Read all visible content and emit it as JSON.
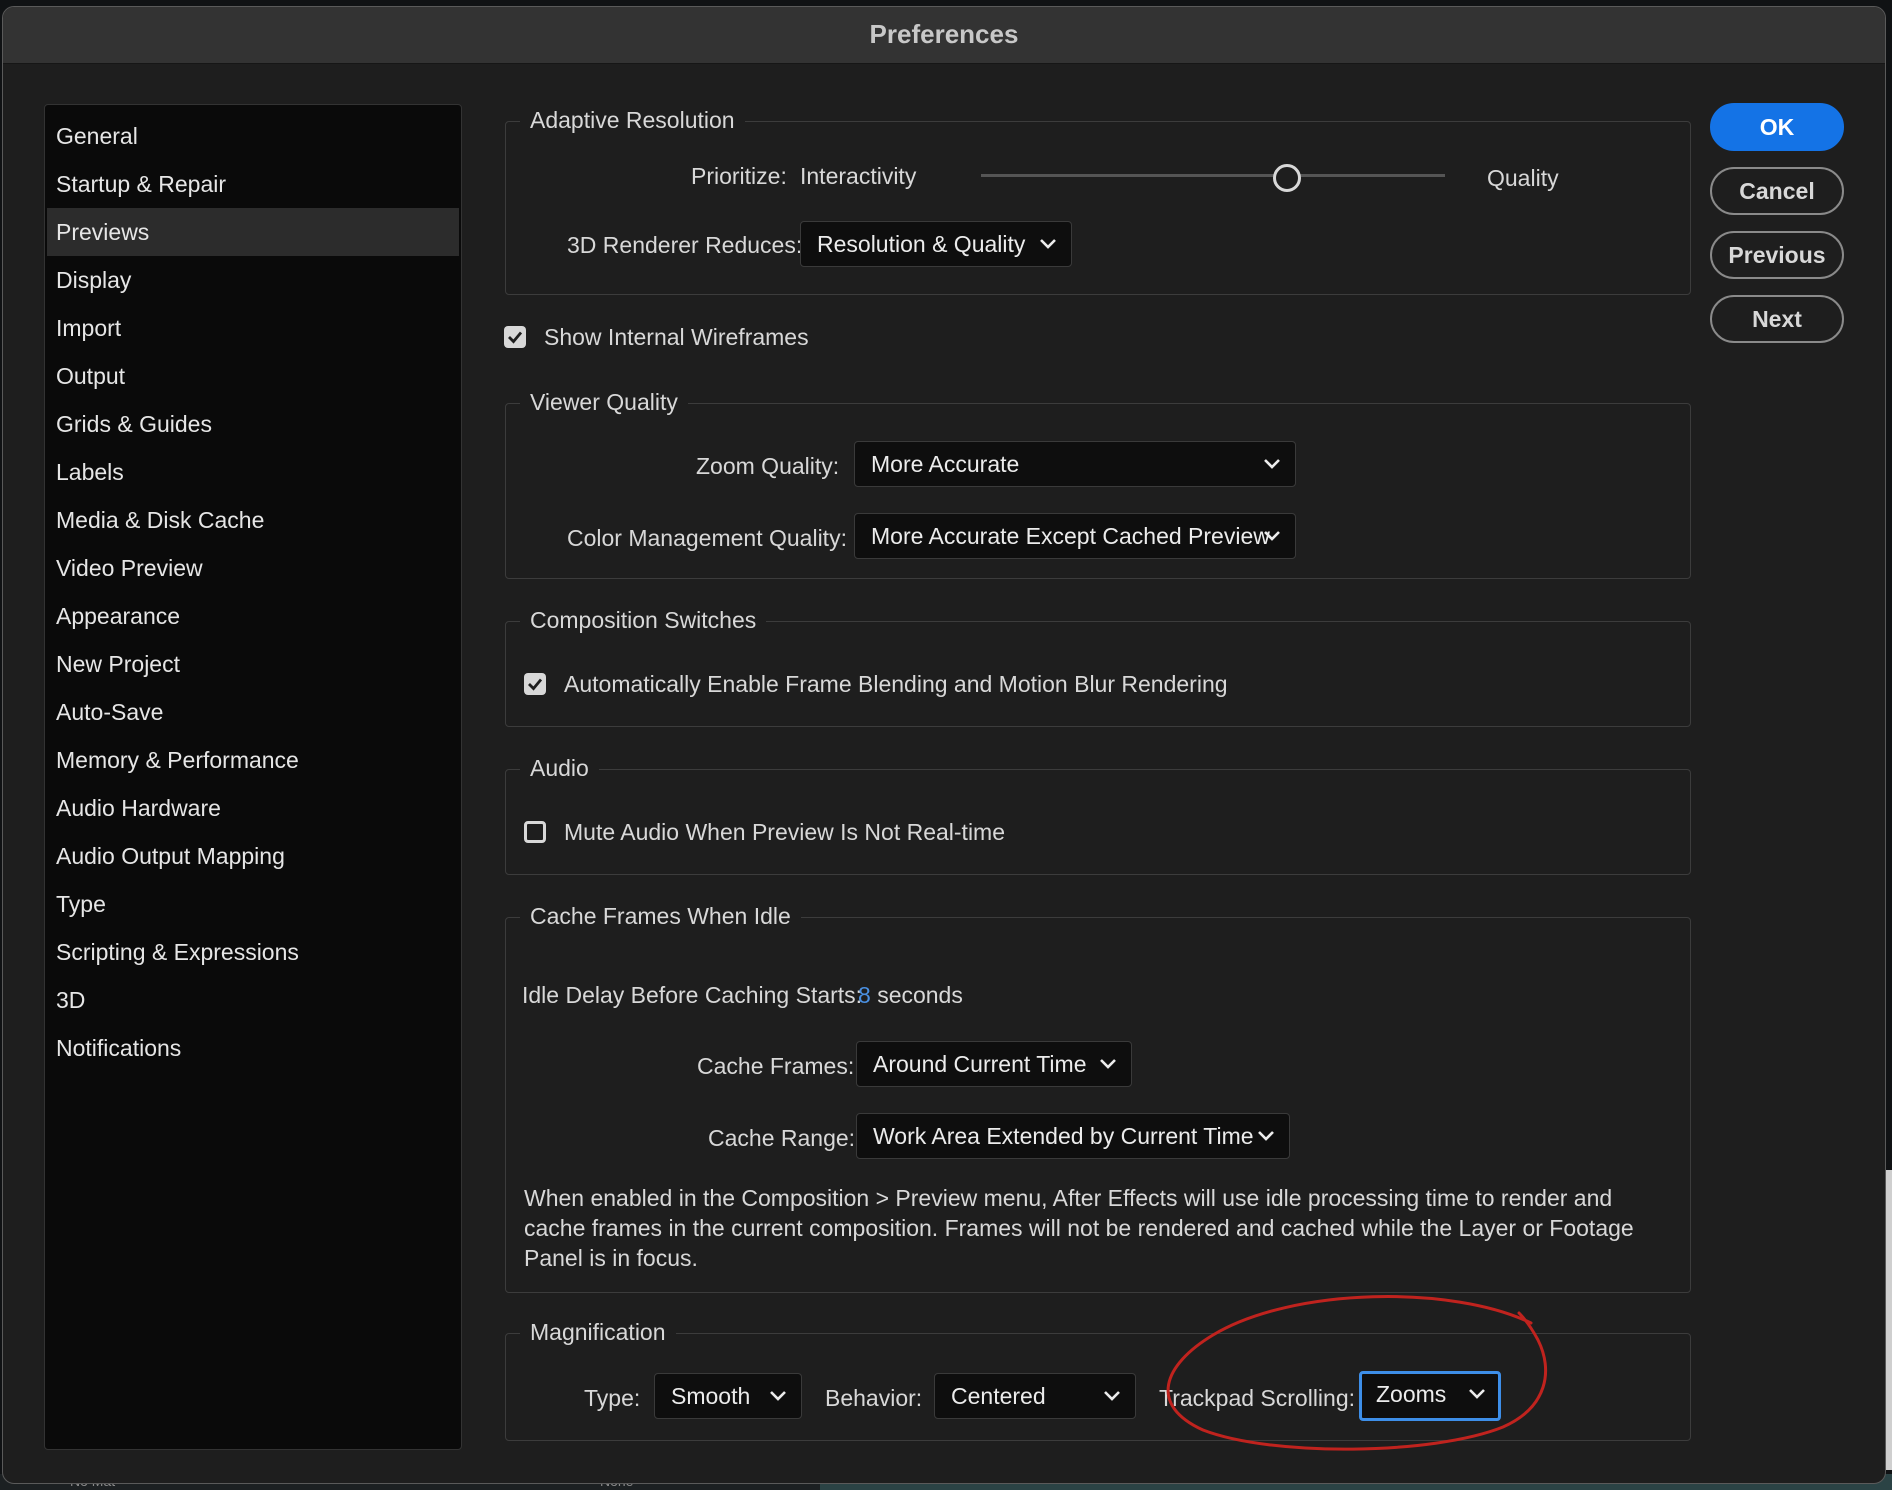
{
  "window": {
    "title": "Preferences"
  },
  "sidebar": {
    "selected": "Previews",
    "items": [
      {
        "label": "General"
      },
      {
        "label": "Startup & Repair"
      },
      {
        "label": "Previews"
      },
      {
        "label": "Display"
      },
      {
        "label": "Import"
      },
      {
        "label": "Output"
      },
      {
        "label": "Grids & Guides"
      },
      {
        "label": "Labels"
      },
      {
        "label": "Media & Disk Cache"
      },
      {
        "label": "Video Preview"
      },
      {
        "label": "Appearance"
      },
      {
        "label": "New Project"
      },
      {
        "label": "Auto-Save"
      },
      {
        "label": "Memory & Performance"
      },
      {
        "label": "Audio Hardware"
      },
      {
        "label": "Audio Output Mapping"
      },
      {
        "label": "Type"
      },
      {
        "label": "Scripting & Expressions"
      },
      {
        "label": "3D"
      },
      {
        "label": "Notifications"
      }
    ]
  },
  "adaptive_resolution": {
    "title": "Adaptive Resolution",
    "prioritize_label": "Prioritize:",
    "left_label": "Interactivity",
    "right_label": "Quality",
    "slider_value": 0.66,
    "renderer_label": "3D Renderer Reduces:",
    "renderer_value": "Resolution & Quality"
  },
  "show_internal_wireframes": {
    "label": "Show Internal Wireframes",
    "checked": true
  },
  "viewer_quality": {
    "title": "Viewer Quality",
    "zoom_label": "Zoom Quality:",
    "zoom_value": "More Accurate",
    "color_label": "Color Management Quality:",
    "color_value": "More Accurate Except Cached Preview"
  },
  "composition_switches": {
    "title": "Composition Switches",
    "frame_blending_label": "Automatically Enable Frame Blending and Motion Blur Rendering",
    "frame_blending_checked": true
  },
  "audio": {
    "title": "Audio",
    "mute_label": "Mute Audio When Preview Is Not Real-time",
    "mute_checked": false
  },
  "cache_frames": {
    "title": "Cache Frames When Idle",
    "idle_label": "Idle Delay Before Caching Starts:",
    "idle_value": "8",
    "idle_unit": "seconds",
    "frames_label": "Cache Frames:",
    "frames_value": "Around Current Time",
    "range_label": "Cache Range:",
    "range_value": "Work Area Extended by Current Time",
    "description": "When enabled in the Composition > Preview menu, After Effects will use idle processing time to render and cache frames in the current composition. Frames will not be rendered and cached while the Layer or Footage Panel is in focus."
  },
  "magnification": {
    "title": "Magnification",
    "type_label": "Type:",
    "type_value": "Smooth",
    "behavior_label": "Behavior:",
    "behavior_value": "Centered",
    "trackpad_label": "Trackpad Scrolling:",
    "trackpad_value": "Zooms"
  },
  "buttons": {
    "ok": "OK",
    "cancel": "Cancel",
    "previous": "Previous",
    "next": "Next"
  },
  "background_bar": {
    "left_text": "No Mat",
    "right_text": "None"
  },
  "colors": {
    "accent": "#1473e6",
    "annotation": "#c0231e",
    "focus": "#3d8ee8"
  }
}
